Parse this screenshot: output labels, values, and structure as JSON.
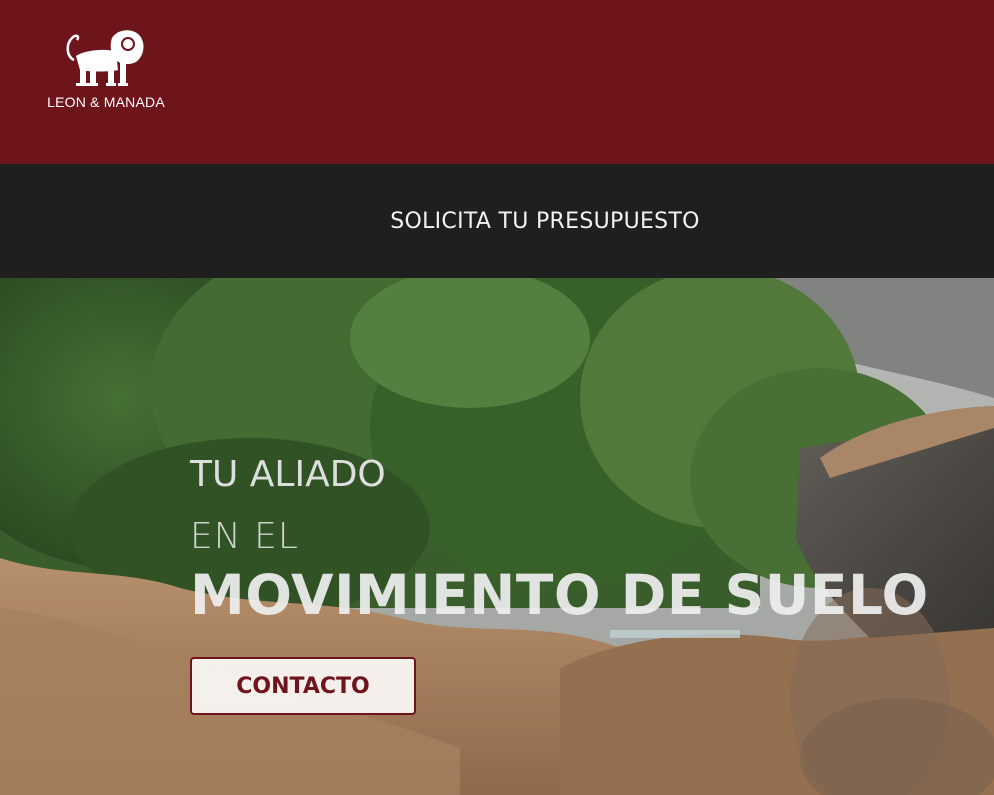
{
  "brand": {
    "name": "LEON & MANADA",
    "logo_icon": "lion-icon",
    "color": "#6e141b"
  },
  "nav": {
    "cta_link": "SOLICITA TU PRESUPUESTO"
  },
  "hero": {
    "line1": "TU ALIADO",
    "line2": "EN EL",
    "line3": "MOVIMIENTO DE SUELO",
    "button": "CONTACTO"
  }
}
